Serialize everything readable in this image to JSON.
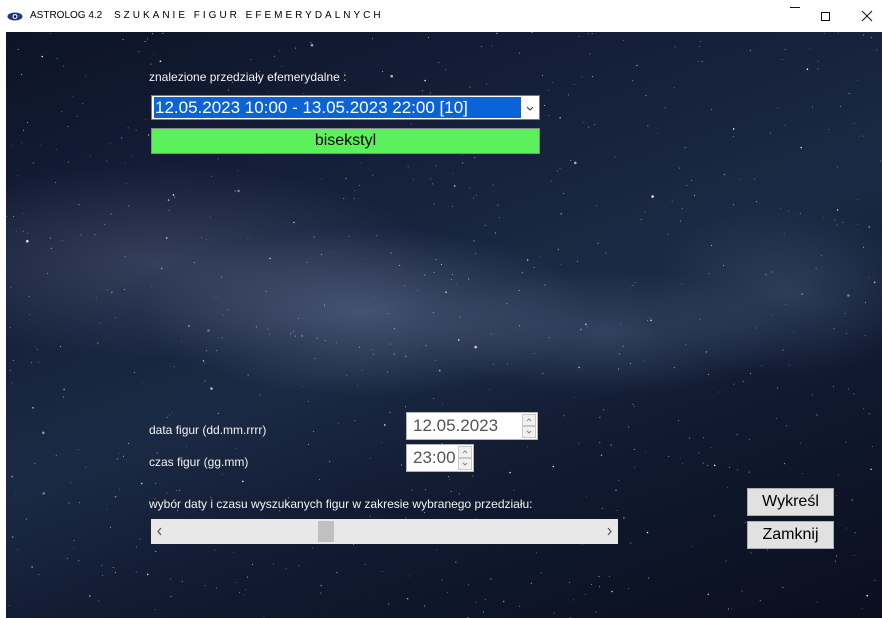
{
  "window": {
    "app_name": "ASTROLOG 4.2",
    "title": "SZUKANIE FIGUR EFEMERYDALNYCH"
  },
  "form": {
    "intervals_label": "znalezione przedziały efemerydalne :",
    "interval_selected": "12.05.2023  10:00 - 13.05.2023  22:00  [10]",
    "status_text": "bisekstyl",
    "status_color": "#5bf15b",
    "date_label": "data figur (dd.mm.rrrr)",
    "date_value": "12.05.2023",
    "time_label": "czas figur (gg.mm)",
    "time_value": "23:00",
    "slider_label": "wybór daty i czasu wyszukanych figur w zakresie wybranego przedziału:",
    "slider_position": 0.36
  },
  "buttons": {
    "draw": "Wykreśl",
    "close": "Zamknij"
  },
  "colors": {
    "selection": "#0a64d6",
    "status": "#5bf15b"
  }
}
